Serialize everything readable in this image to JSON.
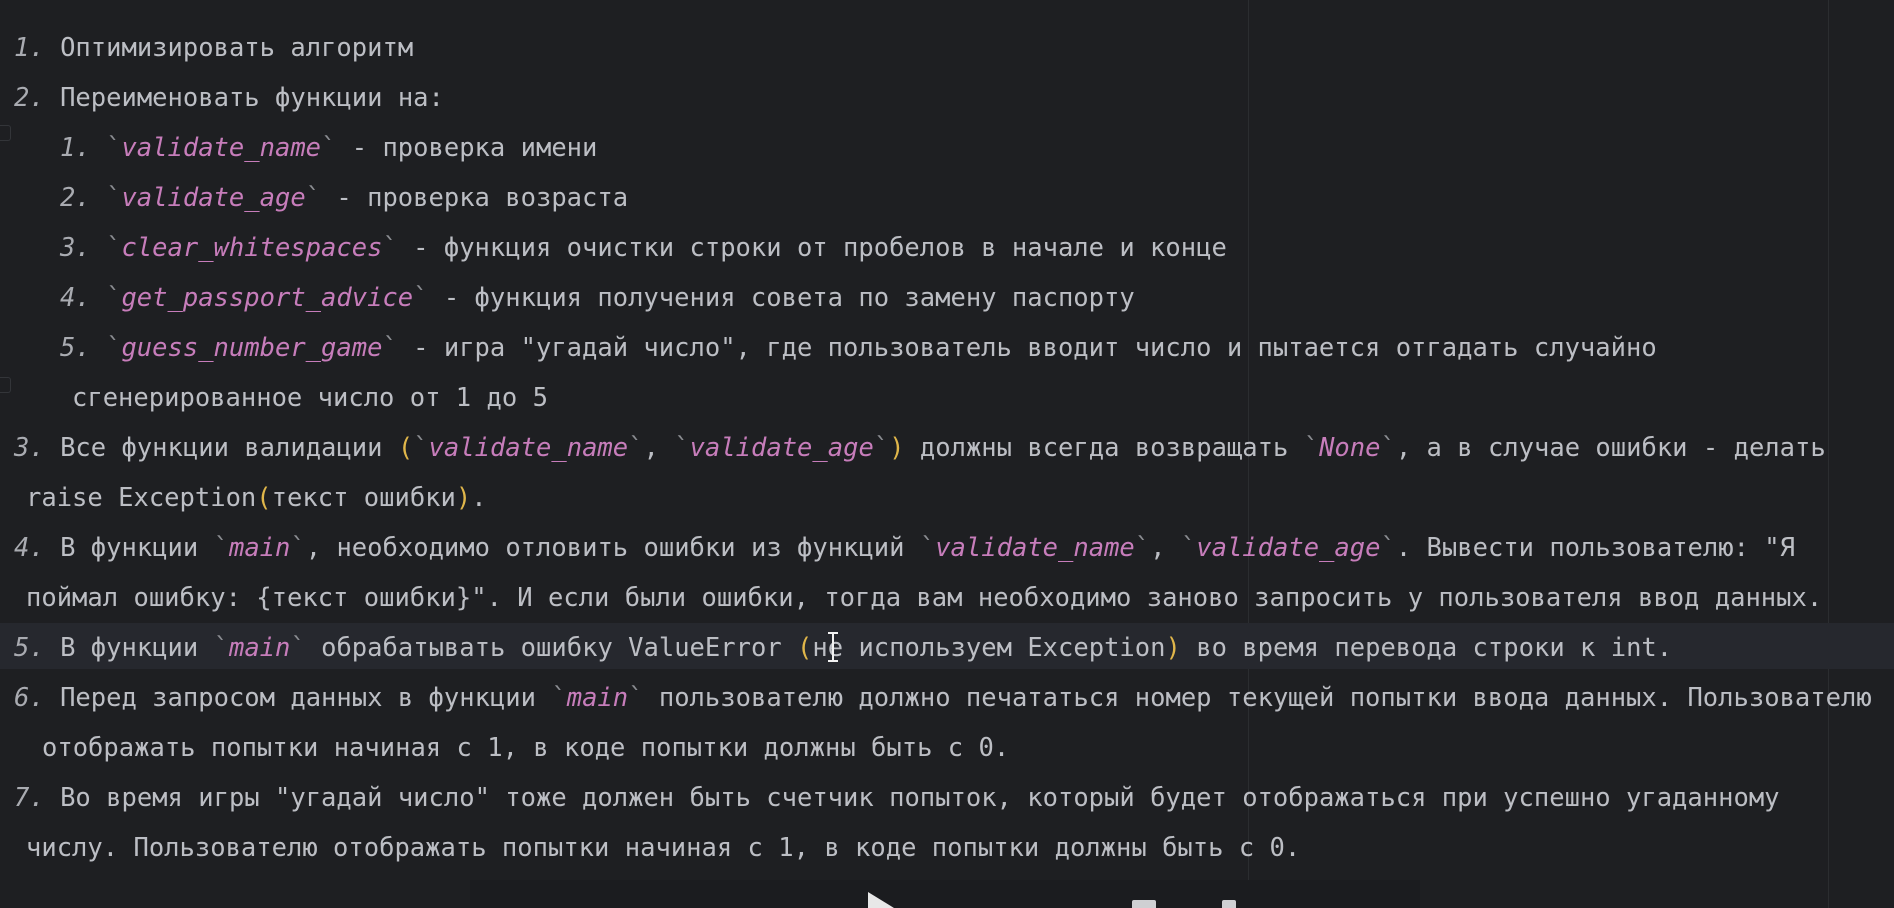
{
  "editor": {
    "lines": [
      {
        "segments": [
          {
            "t": "1.",
            "k": "num"
          },
          {
            "t": " Оптимизировать алгоритм",
            "k": "text"
          }
        ]
      },
      {
        "segments": [
          {
            "t": "2.",
            "k": "num"
          },
          {
            "t": " Переименовать функции на:",
            "k": "text"
          }
        ]
      },
      {
        "segments": [
          {
            "t": "1.",
            "k": "num"
          },
          {
            "t": " ",
            "k": "text"
          },
          {
            "t": "`",
            "k": "tick"
          },
          {
            "t": "validate_name",
            "k": "code"
          },
          {
            "t": "`",
            "k": "tick"
          },
          {
            "t": " - проверка имени",
            "k": "text"
          }
        ]
      },
      {
        "segments": [
          {
            "t": "2.",
            "k": "num"
          },
          {
            "t": " ",
            "k": "text"
          },
          {
            "t": "`",
            "k": "tick"
          },
          {
            "t": "validate_age",
            "k": "code"
          },
          {
            "t": "`",
            "k": "tick"
          },
          {
            "t": " - проверка возраста",
            "k": "text"
          }
        ]
      },
      {
        "segments": [
          {
            "t": "3.",
            "k": "num"
          },
          {
            "t": " ",
            "k": "text"
          },
          {
            "t": "`",
            "k": "tick"
          },
          {
            "t": "clear_whitespaces",
            "k": "code"
          },
          {
            "t": "`",
            "k": "tick"
          },
          {
            "t": " - функция очистки строки от пробелов в начале и конце",
            "k": "text"
          }
        ]
      },
      {
        "segments": [
          {
            "t": "4.",
            "k": "num"
          },
          {
            "t": " ",
            "k": "text"
          },
          {
            "t": "`",
            "k": "tick"
          },
          {
            "t": "get_passport_advice",
            "k": "code"
          },
          {
            "t": "`",
            "k": "tick"
          },
          {
            "t": " - функция получения совета по замену паспорту",
            "k": "text"
          }
        ]
      },
      {
        "segments": [
          {
            "t": "5.",
            "k": "num"
          },
          {
            "t": " ",
            "k": "text"
          },
          {
            "t": "`",
            "k": "tick"
          },
          {
            "t": "guess_number_game",
            "k": "code"
          },
          {
            "t": "`",
            "k": "tick"
          },
          {
            "t": " - игра \"угадай число\", где пользователь вводит число и пытается отгадать случайно",
            "k": "text"
          }
        ]
      },
      {
        "segments": [
          {
            "t": "сгенерированное число от 1 до 5",
            "k": "text"
          }
        ]
      },
      {
        "segments": [
          {
            "t": "3.",
            "k": "num"
          },
          {
            "t": " Все функции валидации ",
            "k": "text"
          },
          {
            "t": "(",
            "k": "paren"
          },
          {
            "t": "`",
            "k": "tick"
          },
          {
            "t": "validate_name",
            "k": "code"
          },
          {
            "t": "`",
            "k": "tick"
          },
          {
            "t": ", ",
            "k": "text"
          },
          {
            "t": "`",
            "k": "tick"
          },
          {
            "t": "validate_age",
            "k": "code"
          },
          {
            "t": "`",
            "k": "tick"
          },
          {
            "t": ")",
            "k": "paren"
          },
          {
            "t": " должны всегда возвращать ",
            "k": "text"
          },
          {
            "t": "`",
            "k": "tick"
          },
          {
            "t": "None",
            "k": "code"
          },
          {
            "t": "`",
            "k": "tick"
          },
          {
            "t": ", а в случае ошибки - делать",
            "k": "text"
          }
        ]
      },
      {
        "segments": [
          {
            "t": "raise Exception",
            "k": "text"
          },
          {
            "t": "(",
            "k": "paren"
          },
          {
            "t": "текст ошибки",
            "k": "text"
          },
          {
            "t": ")",
            "k": "paren"
          },
          {
            "t": ".",
            "k": "text"
          }
        ]
      },
      {
        "segments": [
          {
            "t": "4.",
            "k": "num"
          },
          {
            "t": " В функции ",
            "k": "text"
          },
          {
            "t": "`",
            "k": "tick"
          },
          {
            "t": "main",
            "k": "code"
          },
          {
            "t": "`",
            "k": "tick"
          },
          {
            "t": ", необходимо отловить ошибки из функций ",
            "k": "text"
          },
          {
            "t": "`",
            "k": "tick"
          },
          {
            "t": "validate_name",
            "k": "code"
          },
          {
            "t": "`",
            "k": "tick"
          },
          {
            "t": ", ",
            "k": "text"
          },
          {
            "t": "`",
            "k": "tick"
          },
          {
            "t": "validate_age",
            "k": "code"
          },
          {
            "t": "`",
            "k": "tick"
          },
          {
            "t": ". Вывести пользователю: \"Я",
            "k": "text"
          }
        ]
      },
      {
        "segments": [
          {
            "t": "поймал ошибку: {текст ошибки}\". И если были ошибки, тогда вам необходимо заново запросить у пользователя ввод данных.",
            "k": "text"
          }
        ]
      },
      {
        "segments": [
          {
            "t": "5.",
            "k": "num"
          },
          {
            "t": " В функции ",
            "k": "text"
          },
          {
            "t": "`",
            "k": "tick"
          },
          {
            "t": "main",
            "k": "code"
          },
          {
            "t": "`",
            "k": "tick"
          },
          {
            "t": " обрабатывать ошибку ValueError ",
            "k": "text"
          },
          {
            "t": "(",
            "k": "paren"
          },
          {
            "t": "не используем Exception",
            "k": "text"
          },
          {
            "t": ")",
            "k": "paren"
          },
          {
            "t": " во время перевода строки к int.",
            "k": "text"
          }
        ]
      },
      {
        "segments": [
          {
            "t": "6.",
            "k": "num"
          },
          {
            "t": " Перед запросом данных в функции ",
            "k": "text"
          },
          {
            "t": "`",
            "k": "tick"
          },
          {
            "t": "main",
            "k": "code"
          },
          {
            "t": "`",
            "k": "tick"
          },
          {
            "t": " пользователю должно печататься номер текущей попытки ввода данных. Пользователю",
            "k": "text"
          }
        ]
      },
      {
        "segments": [
          {
            "t": "отображать попытки начиная с 1, в коде попытки должны быть с 0.",
            "k": "text"
          }
        ]
      },
      {
        "segments": [
          {
            "t": "7.",
            "k": "num"
          },
          {
            "t": " Во время игры \"угадай число\" тоже должен быть счетчик попыток, который будет отображаться при успешно угаданному",
            "k": "text"
          }
        ]
      },
      {
        "segments": [
          {
            "t": "числу. Пользователю отображать попытки начиная с 1, в коде попытки должны быть с 0.",
            "k": "text"
          }
        ]
      }
    ]
  },
  "colors": {
    "background": "#1e1f22",
    "text": "#bcbec4",
    "code": "#c77dbb",
    "paren": "#e0b64a",
    "number": "#a9abb1"
  },
  "icons": {
    "cursor": "text-cursor-icon",
    "player": "play-icon"
  }
}
